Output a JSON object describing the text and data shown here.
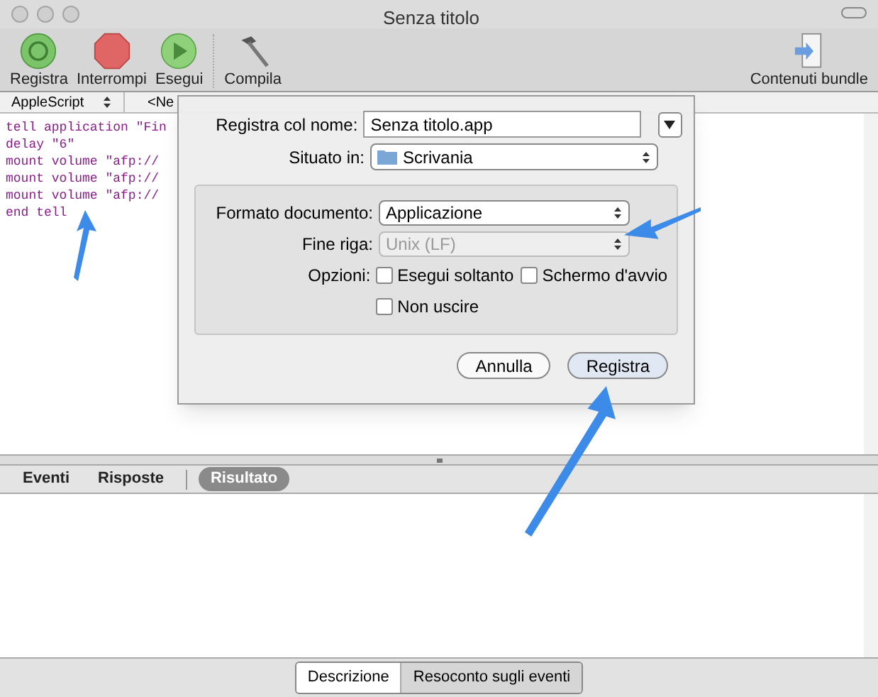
{
  "window": {
    "title": "Senza titolo"
  },
  "toolbar": [
    {
      "label": "Registra",
      "kind": "record"
    },
    {
      "label": "Interrompi",
      "kind": "stop"
    },
    {
      "label": "Esegui",
      "kind": "run"
    },
    {
      "label": "Compila",
      "kind": "compile"
    },
    {
      "label": "Contenuti bundle",
      "kind": "bundle"
    }
  ],
  "navigation_bar": {
    "language": "AppleScript",
    "element": "<Ne"
  },
  "editor": {
    "lines": [
      "tell application \"Fin",
      "delay \"6\"",
      "mount volume \"afp://",
      "mount volume \"afp://",
      "mount volume \"afp://",
      "end tell"
    ]
  },
  "save_sheet": {
    "name_label": "Registra col nome:",
    "name_value": "Senza titolo.app",
    "location_label": "Situato in:",
    "location_value": "Scrivania",
    "format_label": "Formato documento:",
    "format_value": "Applicazione",
    "line_ending_label": "Fine riga:",
    "line_ending_value": "Unix (LF)",
    "line_ending_disabled": true,
    "options_label": "Opzioni:",
    "options": [
      {
        "label": "Esegui soltanto",
        "checked": false
      },
      {
        "label": "Schermo d'avvio",
        "checked": false
      },
      {
        "label": "Non uscire",
        "checked": false
      }
    ],
    "buttons": [
      {
        "label": "Annulla",
        "default": false
      },
      {
        "label": "Registra",
        "default": true
      }
    ]
  },
  "result_tabs": [
    {
      "label": "Eventi",
      "selected": false
    },
    {
      "label": "Risposte",
      "selected": false
    },
    {
      "label": "Risultato",
      "selected": true
    }
  ],
  "bottom_segments": [
    {
      "label": "Descrizione",
      "selected": false
    },
    {
      "label": "Resoconto sugli eventi",
      "selected": true
    }
  ]
}
